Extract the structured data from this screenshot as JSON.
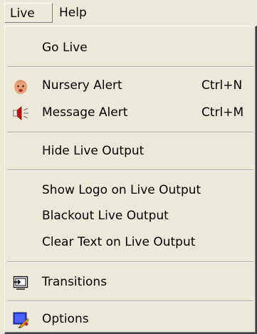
{
  "menubar": {
    "items": [
      {
        "label": "Live"
      },
      {
        "label": "Help"
      }
    ]
  },
  "menu": {
    "go_live": {
      "label": "Go Live"
    },
    "nursery_alert": {
      "label": "Nursery Alert",
      "shortcut": "Ctrl+N",
      "icon": "baby-face-icon"
    },
    "message_alert": {
      "label": "Message Alert",
      "shortcut": "Ctrl+M",
      "icon": "speaker-icon"
    },
    "hide_live_output": {
      "label": "Hide Live Output"
    },
    "show_logo": {
      "label": "Show Logo on Live Output"
    },
    "blackout": {
      "label": "Blackout Live Output"
    },
    "clear_text": {
      "label": "Clear Text on Live Output"
    },
    "transitions": {
      "label": "Transitions",
      "icon": "transitions-icon"
    },
    "options": {
      "label": "Options",
      "icon": "options-icon"
    }
  },
  "colors": {
    "background": "#ece9d8",
    "separator_dark": "#aca899",
    "separator_light": "#ffffff"
  }
}
